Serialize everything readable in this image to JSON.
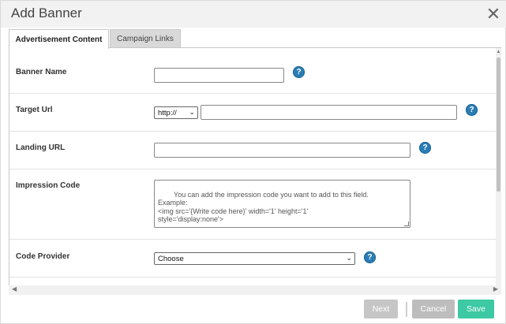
{
  "dialog": {
    "title": "Add Banner",
    "close_icon": "close-icon"
  },
  "tabs": [
    {
      "label": "Advertisement Content",
      "active": true
    },
    {
      "label": "Campaign Links",
      "active": false
    }
  ],
  "form": {
    "banner_name": {
      "label": "Banner Name",
      "value": ""
    },
    "target_url": {
      "label": "Target Url",
      "protocol": "http://",
      "value": ""
    },
    "landing_url": {
      "label": "Landing URL",
      "value": ""
    },
    "impression_code": {
      "label": "Impression Code",
      "placeholder": "You can add the impression code you want to add to this field.\nExample:\n<img src='{Write code here}' width='1' height='1'\nstyle='display:none'>"
    },
    "code_provider": {
      "label": "Code Provider",
      "selected": "Choose"
    }
  },
  "help_icon": "help-icon",
  "help_glyph": "?",
  "buttons": {
    "next": "Next",
    "cancel": "Cancel",
    "save": "Save"
  },
  "colors": {
    "save": "#3cc9a3",
    "help": "#2a7db5",
    "disabled": "#c6c6c6"
  }
}
